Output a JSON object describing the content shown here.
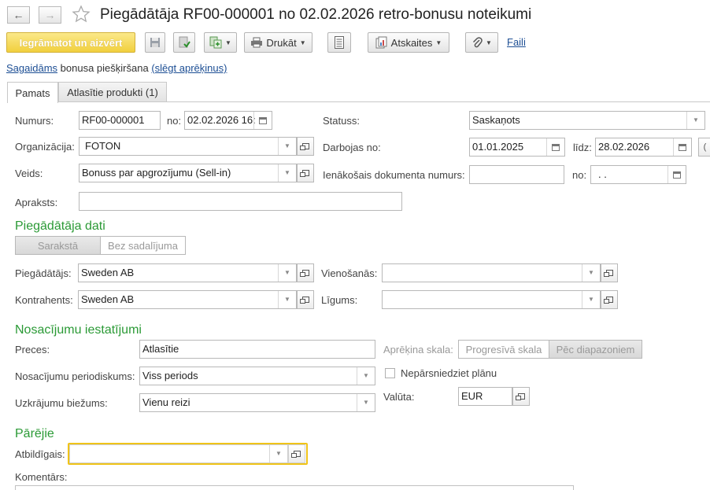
{
  "header": {
    "back_icon": "←",
    "forward_icon": "→",
    "title": "Piegādātāja RF00-000001 no 02.02.2026 retro-bonusu noteikumi"
  },
  "toolbar": {
    "post_close": "Iegrāmatot un aizvērt",
    "print": "Drukāt",
    "reports": "Atskaites",
    "files": "Faili"
  },
  "status_line": {
    "link1": "Sagaidāms",
    "middle": "bonusa piešķiršana",
    "link2": "(slēgt aprēķinus)"
  },
  "tabs": {
    "main": "Pamats",
    "products": "Atlasītie produkti (1)"
  },
  "fields": {
    "number_label": "Numurs:",
    "number": "RF00-000001",
    "from_label": "no:",
    "date": "02.02.2026 16:",
    "status_label": "Statuss:",
    "status": "Saskaņots",
    "org_label": "Organizācija:",
    "org": "FOTON",
    "works_from_label": "Darbojas no:",
    "works_from": "01.01.2025",
    "until_label": "līdz:",
    "until": "28.02.2026",
    "type_label": "Veids:",
    "type": "Bonuss par apgrozījumu (Sell-in)",
    "incoming_label": "Ienākošais dokumenta numurs:",
    "incoming": "",
    "incoming_from_label": "no:",
    "incoming_date": " .  .",
    "desc_label": "Apraksts:",
    "desc": ""
  },
  "supplier_section": {
    "title": "Piegādātāja dati",
    "seg_list": "Sarakstā",
    "seg_none": "Bez sadalījuma",
    "supplier_label": "Piegādātājs:",
    "supplier": "Sweden AB",
    "agreement_label": "Vienošanās:",
    "agreement": "",
    "counterparty_label": "Kontrahents:",
    "counterparty": "Sweden AB",
    "contract_label": "Līgums:",
    "contract": ""
  },
  "conditions_section": {
    "title": "Nosacījumu iestatījumi",
    "goods_label": "Preces:",
    "goods": "Atlasītie",
    "scale_label": "Aprēķina skala:",
    "scale_progressive": "Progresīvā skala",
    "scale_ranges": "Pēc diapazoniem",
    "period_label": "Nosacījumu periodiskums:",
    "period": "Viss periods",
    "no_exceed_label": "Nepārsniedziet plānu",
    "currency_label": "Valūta:",
    "currency": "EUR",
    "accrual_label": "Uzkrājumu biežums:",
    "accrual": "Vienu reizi"
  },
  "other_section": {
    "title": "Pārējie",
    "responsible_label": "Atbildīgais:",
    "responsible": "",
    "comment_label": "Komentārs:"
  },
  "colors": {
    "primary_button": "#f1cf3d",
    "section_title": "#2b9a36",
    "link": "#1c4e94",
    "focus_border": "#f0c419"
  }
}
